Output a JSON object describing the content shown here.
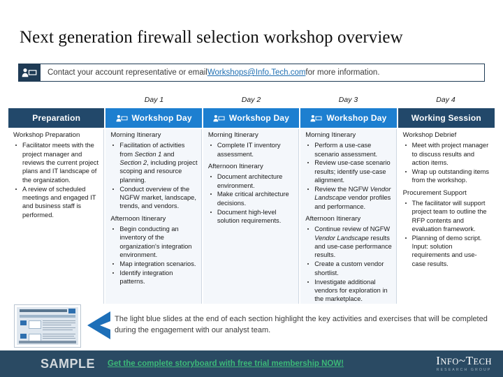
{
  "title": "Next generation firewall selection workshop overview",
  "contact_banner": {
    "icon": "person-presentation-icon",
    "text_before": "Contact your account representative or email ",
    "link": "Workshops@Info.Tech.com",
    "text_after": " for more information."
  },
  "colors": {
    "dark_navy": "#22486a",
    "bright_blue": "#1d7fd0",
    "footer_navy": "#2a4a63",
    "cta_green": "#3cb878",
    "link_blue": "#1f6fb2",
    "tint": "#f4f7fb"
  },
  "day_labels": [
    "",
    "Day 1",
    "Day 2",
    "Day 3",
    "Day 4"
  ],
  "columns": [
    {
      "header": "Preparation",
      "header_icon": "",
      "header_style": "dark",
      "tint": false,
      "sections": [
        {
          "title": "Workshop Preparation",
          "bullets": [
            "Facilitator meets with the project manager and reviews the current project plans and IT landscape of the organization.",
            "A review of scheduled meetings and engaged IT and business staff is performed."
          ]
        }
      ]
    },
    {
      "header": "Workshop Day",
      "header_icon": "person-presentation-icon",
      "header_style": "bright",
      "tint": true,
      "sections": [
        {
          "title": "Morning Itinerary",
          "bullets": [
            "Facilitation of activities from Section 1 and Section 2, including project scoping and resource planning.",
            "Conduct overview of the NGFW market, landscape, trends, and vendors."
          ]
        },
        {
          "title": "Afternoon Itinerary",
          "bullets": [
            "Begin conducting an inventory of the organization's integration environment.",
            "Map integration scenarios.",
            "Identify integration patterns."
          ]
        }
      ]
    },
    {
      "header": "Workshop Day",
      "header_icon": "person-presentation-icon",
      "header_style": "bright",
      "tint": true,
      "sections": [
        {
          "title": "Morning Itinerary",
          "bullets": [
            "Complete IT inventory assessment."
          ]
        },
        {
          "title": "Afternoon Itinerary",
          "bullets": [
            "Document architecture environment.",
            "Make critical architecture decisions.",
            "Document high-level solution requirements."
          ]
        }
      ]
    },
    {
      "header": "Workshop Day",
      "header_icon": "person-presentation-icon",
      "header_style": "bright",
      "tint": true,
      "sections": [
        {
          "title": "Morning Itinerary",
          "bullets": [
            "Perform a use-case scenario assessment.",
            "Review use-case scenario results; identify use-case alignment.",
            "Review the NGFW Vendor Landscape vendor profiles and performance."
          ]
        },
        {
          "title": "Afternoon Itinerary",
          "bullets": [
            "Continue review of NGFW Vendor Landscape results and use-case performance results.",
            "Create a custom vendor shortlist.",
            "Investigate additional vendors for exploration in the marketplace."
          ]
        }
      ]
    },
    {
      "header": "Working Session",
      "header_icon": "",
      "header_style": "dark",
      "tint": false,
      "sections": [
        {
          "title": "Workshop Debrief",
          "bullets": [
            "Meet with project manager to discuss results and action items.",
            "Wrap up outstanding items from the workshop."
          ]
        },
        {
          "title": "Procurement Support",
          "bullets": [
            "The facilitator will support project team to outline the RFP contents and evaluation framework.",
            "Planning of demo script. Input: solution requirements and use-case results."
          ]
        }
      ]
    }
  ],
  "bottom_note": {
    "thumbnail_alt": "slide-thumbnail",
    "chevron": "chevron-left-icon",
    "text": "The light blue slides at the end of each section highlight the key activities and exercises that will be completed during the engagement with our analyst team."
  },
  "footer": {
    "sample_label": "SAMPLE",
    "cta": "Get the complete storyboard with free trial membership NOW!",
    "logo_primary": "I",
    "logo_text": "NFO",
    "logo_sep": "~",
    "logo_text2": "ECH",
    "logo_t": "T",
    "logo_tagline": "RESEARCH GROUP"
  }
}
